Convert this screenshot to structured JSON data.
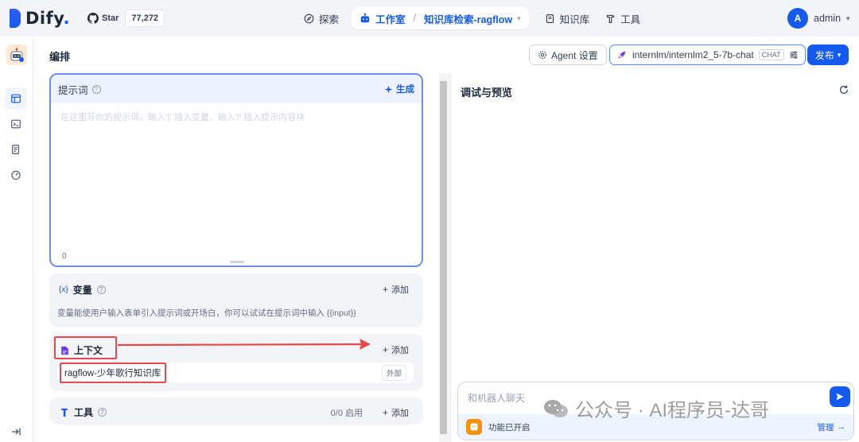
{
  "brand": {
    "name": "Dify",
    "dot": ".",
    "accent_color": "#155aef"
  },
  "github": {
    "label": "Star",
    "count": "77,272"
  },
  "nav": {
    "explore": "探索",
    "studio": "工作室",
    "app_name": "知识库检索-ragflow",
    "knowledge": "知识库",
    "tools": "工具"
  },
  "user": {
    "initial": "A",
    "name": "admin"
  },
  "header": {
    "title": "编排",
    "agent_settings": "Agent 设置",
    "model": "internlm/internlm2_5-7b-chat",
    "model_tag": "CHAT",
    "publish": "发布"
  },
  "prompt": {
    "title": "提示词",
    "generate": "生成",
    "placeholder": "在这里写你的提示词，输入'{' 插入变量、输入'/' 插入提示内容块",
    "count": "0"
  },
  "variables": {
    "icon_text": "{x}",
    "title": "变量",
    "add": "添加",
    "description": "变量能使用户输入表单引入提示词或开场白，你可以试试在提示词中输入 {{input}}"
  },
  "context": {
    "title": "上下文",
    "add": "添加",
    "item": "ragflow-少年歌行知识库",
    "item_tag": "外部"
  },
  "tools": {
    "title": "工具",
    "count": "0/0 启用",
    "add": "添加"
  },
  "debug": {
    "title": "调试与预览",
    "input_placeholder": "和机器人聊天",
    "features_status": "功能已开启",
    "manage": "管理"
  },
  "watermark": {
    "text": "公众号 · AI程序员-达哥"
  },
  "annotation_color": "#e5484d"
}
